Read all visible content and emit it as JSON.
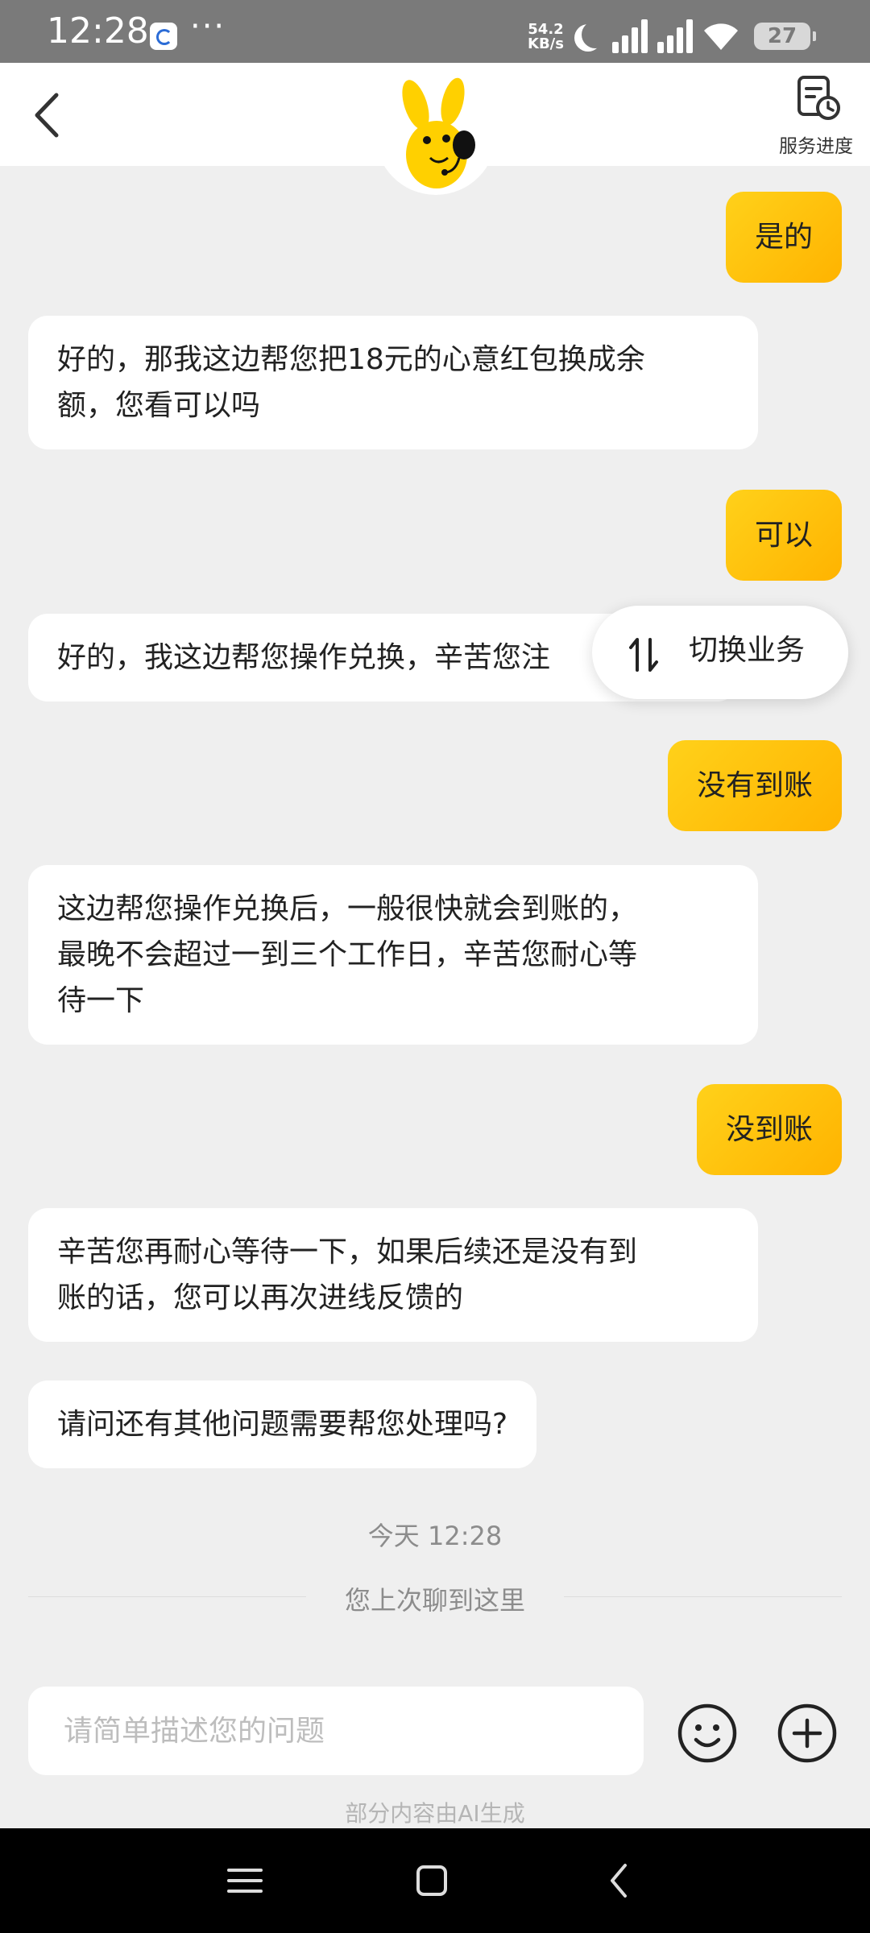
{
  "status_bar": {
    "time": "12:28",
    "more": "···",
    "speed_value": "54.2",
    "speed_unit": "KB/s",
    "battery": "27",
    "icons": [
      "app-notification-icon",
      "moon-icon",
      "signal-icon",
      "signal-icon",
      "wifi-icon",
      "battery-icon"
    ]
  },
  "header": {
    "back_icon": "chevron-left-icon",
    "avatar": "yellow-rabbit-mascot-avatar",
    "progress_label": "服务进度",
    "progress_icon": "document-clock-icon"
  },
  "messages": [
    {
      "from": "user",
      "text": "是的"
    },
    {
      "from": "bot",
      "text": "好的，那我这边帮您把18元的心意红包换成余\n额，您看可以吗"
    },
    {
      "from": "user",
      "text": "可以"
    },
    {
      "from": "bot",
      "text": "好的，我这边帮您操作兑换，辛苦您注"
    },
    {
      "from": "user",
      "text": "没有到账"
    },
    {
      "from": "bot",
      "text": "这边帮您操作兑换后，一般很快就会到账的，\n最晚不会超过一到三个工作日，辛苦您耐心等\n待一下"
    },
    {
      "from": "user",
      "text": "没到账"
    },
    {
      "from": "bot",
      "text": "辛苦您再耐心等待一下，如果后续还是没有到\n账的话，您可以再次进线反馈的"
    },
    {
      "from": "bot",
      "text": "请问还有其他问题需要帮您处理吗?"
    }
  ],
  "switch_business": {
    "label": "切换业务",
    "icon": "swap-vertical-icon"
  },
  "timestamp": "今天 12:28",
  "last_read": "您上次聊到这里",
  "input": {
    "placeholder": "请简单描述您的问题",
    "emoji_icon": "smile-icon",
    "plus_icon": "plus-circle-icon"
  },
  "ai_note": "部分内容由AI生成",
  "nav": [
    "menu-icon",
    "home-square-icon",
    "back-icon"
  ],
  "colors": {
    "user_bubble": "#FFC107",
    "background": "#EFEFEF",
    "accent": "#FFB300"
  }
}
